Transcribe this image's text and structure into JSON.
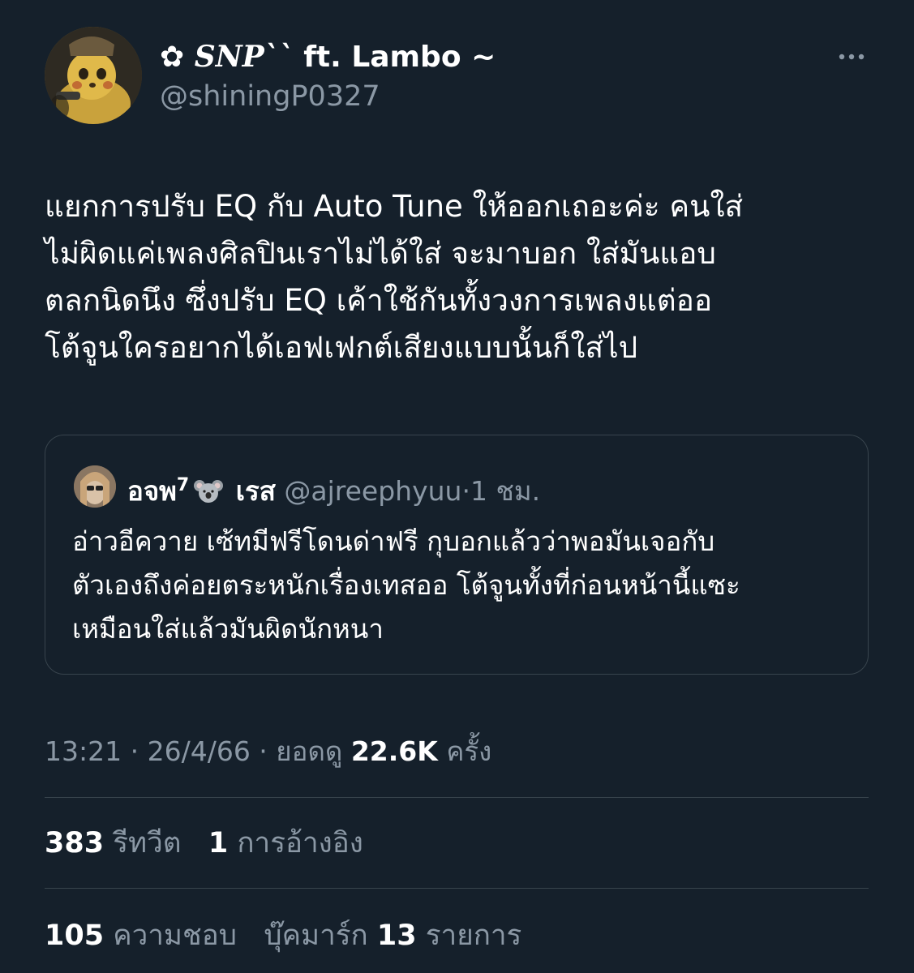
{
  "author": {
    "display_name_symbol": "✿",
    "display_name_styled": "SNP``",
    "display_name_rest": " ft. Lambo ~",
    "handle": "@shiningP0327"
  },
  "tweet": {
    "lines": [
      "แยกการปรับ EQ กับ Auto Tune ให้ออกเถอะค่ะ คนใส่",
      "ไม่ผิดแค่เพลงศิลปินเราไม่ได้ใส่ จะมาบอก ใส่มันแอบ",
      "ตลกนิดนึง ซึ่งปรับ EQ เค้าใช้กันทั้งวงการเพลงแต่ออ",
      "โต้จูนใครอยากได้เอฟเฟกต์เสียงแบบนั้นก็ใส่ไป"
    ]
  },
  "quote": {
    "name": "อจพ",
    "name_sup": "7",
    "name_suffix": "เรส",
    "emoji": "koala-emoji",
    "handle": "@ajreephyuu",
    "separator": "·",
    "time": "1 ชม.",
    "lines": [
      "อ่าวอีควาย เซ้ทมีฟรีโดนด่าฟรี กุบอกแล้วว่าพอมันเจอกับ",
      "ตัวเองถึงค่อยตระหนักเรื่องเทสออ โต้จูนทั้งที่ก่อนหน้านี้แซะ",
      "เหมือนใส่แล้วมันผิดนักหนา"
    ]
  },
  "meta": {
    "time": "13:21",
    "separator1": " · ",
    "date": "26/4/66",
    "separator2": " · ",
    "views_label": "ยอดดู",
    "views_count": "22.6K",
    "views_suffix": "ครั้ง"
  },
  "stats": {
    "retweets_count": "383",
    "retweets_label": "รีทวีต",
    "quotes_count": "1",
    "quotes_label": "การอ้างอิง",
    "likes_count": "105",
    "likes_label": "ความชอบ",
    "bookmarks_label": "บุ๊คมาร์ก",
    "bookmarks_count": "13",
    "bookmarks_suffix": "รายการ"
  },
  "icons": {
    "more": "more-horizontal-icon"
  },
  "colors": {
    "background": "#15202b",
    "text_primary": "#ffffff",
    "text_secondary": "#8b98a5",
    "border": "#38444d"
  }
}
